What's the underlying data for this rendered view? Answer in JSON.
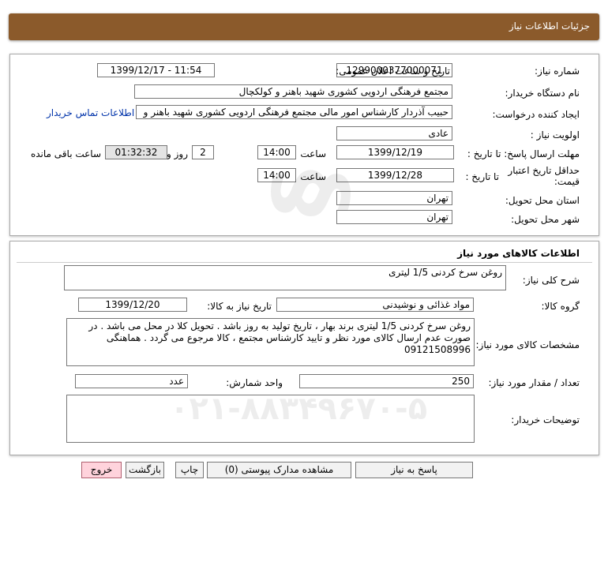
{
  "page_title": "جزئیات اطلاعات نیاز",
  "labels": {
    "need_number": "شماره نیاز:",
    "announce_datetime": "تاریخ و ساعت اعلان عمومی:",
    "buyer_name": "نام دستگاه خریدار:",
    "requester": "ایجاد کننده درخواست:",
    "priority": "اولویت نیاز :",
    "reply_deadline": "مهلت ارسال پاسخ: تا تاریخ :",
    "price_validity": "حداقل تاریخ اعتبار قیمت:",
    "until_date": "تا تاریخ :",
    "time": "ساعت",
    "day_and": "روز و",
    "remaining": "ساعت باقی مانده",
    "province": "استان محل تحویل:",
    "city": "شهر محل تحویل:"
  },
  "values": {
    "need_number": "1299000377000071",
    "announce_datetime": "1399/12/17 - 11:54",
    "buyer_name": "مجتمع فرهنگی اردویی کشوری شهید باهنر و کولکچال",
    "requester": "حبیب آذردار کارشناس امور مالی  مجتمع فرهنگی اردویی کشوری شهید باهنر و",
    "contact_link": "اطلاعات تماس خریدار",
    "priority": "عادی",
    "reply_date": "1399/12/19",
    "reply_time": "14:00",
    "days": "2",
    "remaining_time": "01:32:32",
    "validity_date": "1399/12/28",
    "validity_time": "14:00",
    "province": "تهران",
    "city": "تهران"
  },
  "goods": {
    "section_title": "اطلاعات کالاهای مورد نیاز",
    "labels": {
      "general_desc": "شرح کلی نیاز:",
      "goods_group": "گروه کالا:",
      "need_date": "تاریخ نیاز به کالا:",
      "specs": "مشخصات کالای مورد نیاز:",
      "quantity": "تعداد / مقدار مورد نیاز:",
      "unit": "واحد شمارش:",
      "buyer_notes": "توضیحات خریدار:"
    },
    "general_desc": "روغن سرخ کردنی 1/5 لیتری",
    "goods_group": "مواد غذائی و نوشیدنی",
    "need_date": "1399/12/20",
    "specs": "روغن سرخ کردنی 1/5 لیتری برند بهار ، تاریخ تولید به روز باشد . تحویل کلا در محل می باشد . در صورت عدم ارسال کالای مورد نظر و تایید کارشناس مجتمع ، کالا مرجوع می گردد . هماهنگی 09121508996",
    "quantity": "250",
    "unit": "عدد",
    "buyer_notes": ""
  },
  "buttons": {
    "reply": "پاسخ به نیاز",
    "attachments": "مشاهده مدارک پیوستی (0)",
    "print": "چاپ",
    "back": "بازگشت",
    "exit": "خروج"
  },
  "colors": {
    "title_bar": "#8b5a2b",
    "exit_button": "#ffd3dc",
    "link": "#0033aa"
  }
}
